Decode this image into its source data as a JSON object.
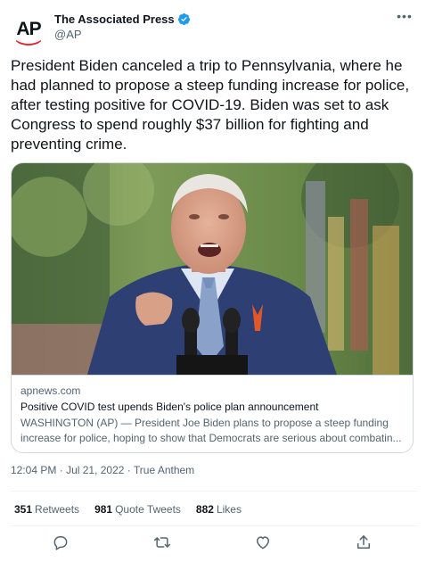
{
  "author": {
    "display_name": "The Associated Press",
    "handle": "@AP",
    "avatar_text": "AP",
    "verified_icon": "verified-badge-icon"
  },
  "tweet": {
    "text": "President Biden canceled a trip to Pennsylvania, where he had planned to propose a steep funding increase for police, after testing positive for COVID-19. Biden was set to ask Congress to spend roughly $37 billion for fighting and preventing crime."
  },
  "card": {
    "domain": "apnews.com",
    "title": "Positive COVID test upends Biden's police plan announcement",
    "description": "WASHINGTON (AP) — President Joe Biden plans to propose a steep funding increase for police, hoping to show that Democrats are serious about combatin..."
  },
  "meta": {
    "time": "12:04 PM",
    "separator1": "·",
    "date": "Jul 21, 2022",
    "separator2": "·",
    "source": "True Anthem"
  },
  "stats": {
    "retweets_count": "351",
    "retweets_label": "Retweets",
    "quotes_count": "981",
    "quotes_label": "Quote Tweets",
    "likes_count": "882",
    "likes_label": "Likes"
  },
  "colors": {
    "text": "#0f1419",
    "secondary": "#536471",
    "border": "#cfd9de",
    "verified": "#1d9bf0",
    "ap_red": "#e0272e"
  }
}
